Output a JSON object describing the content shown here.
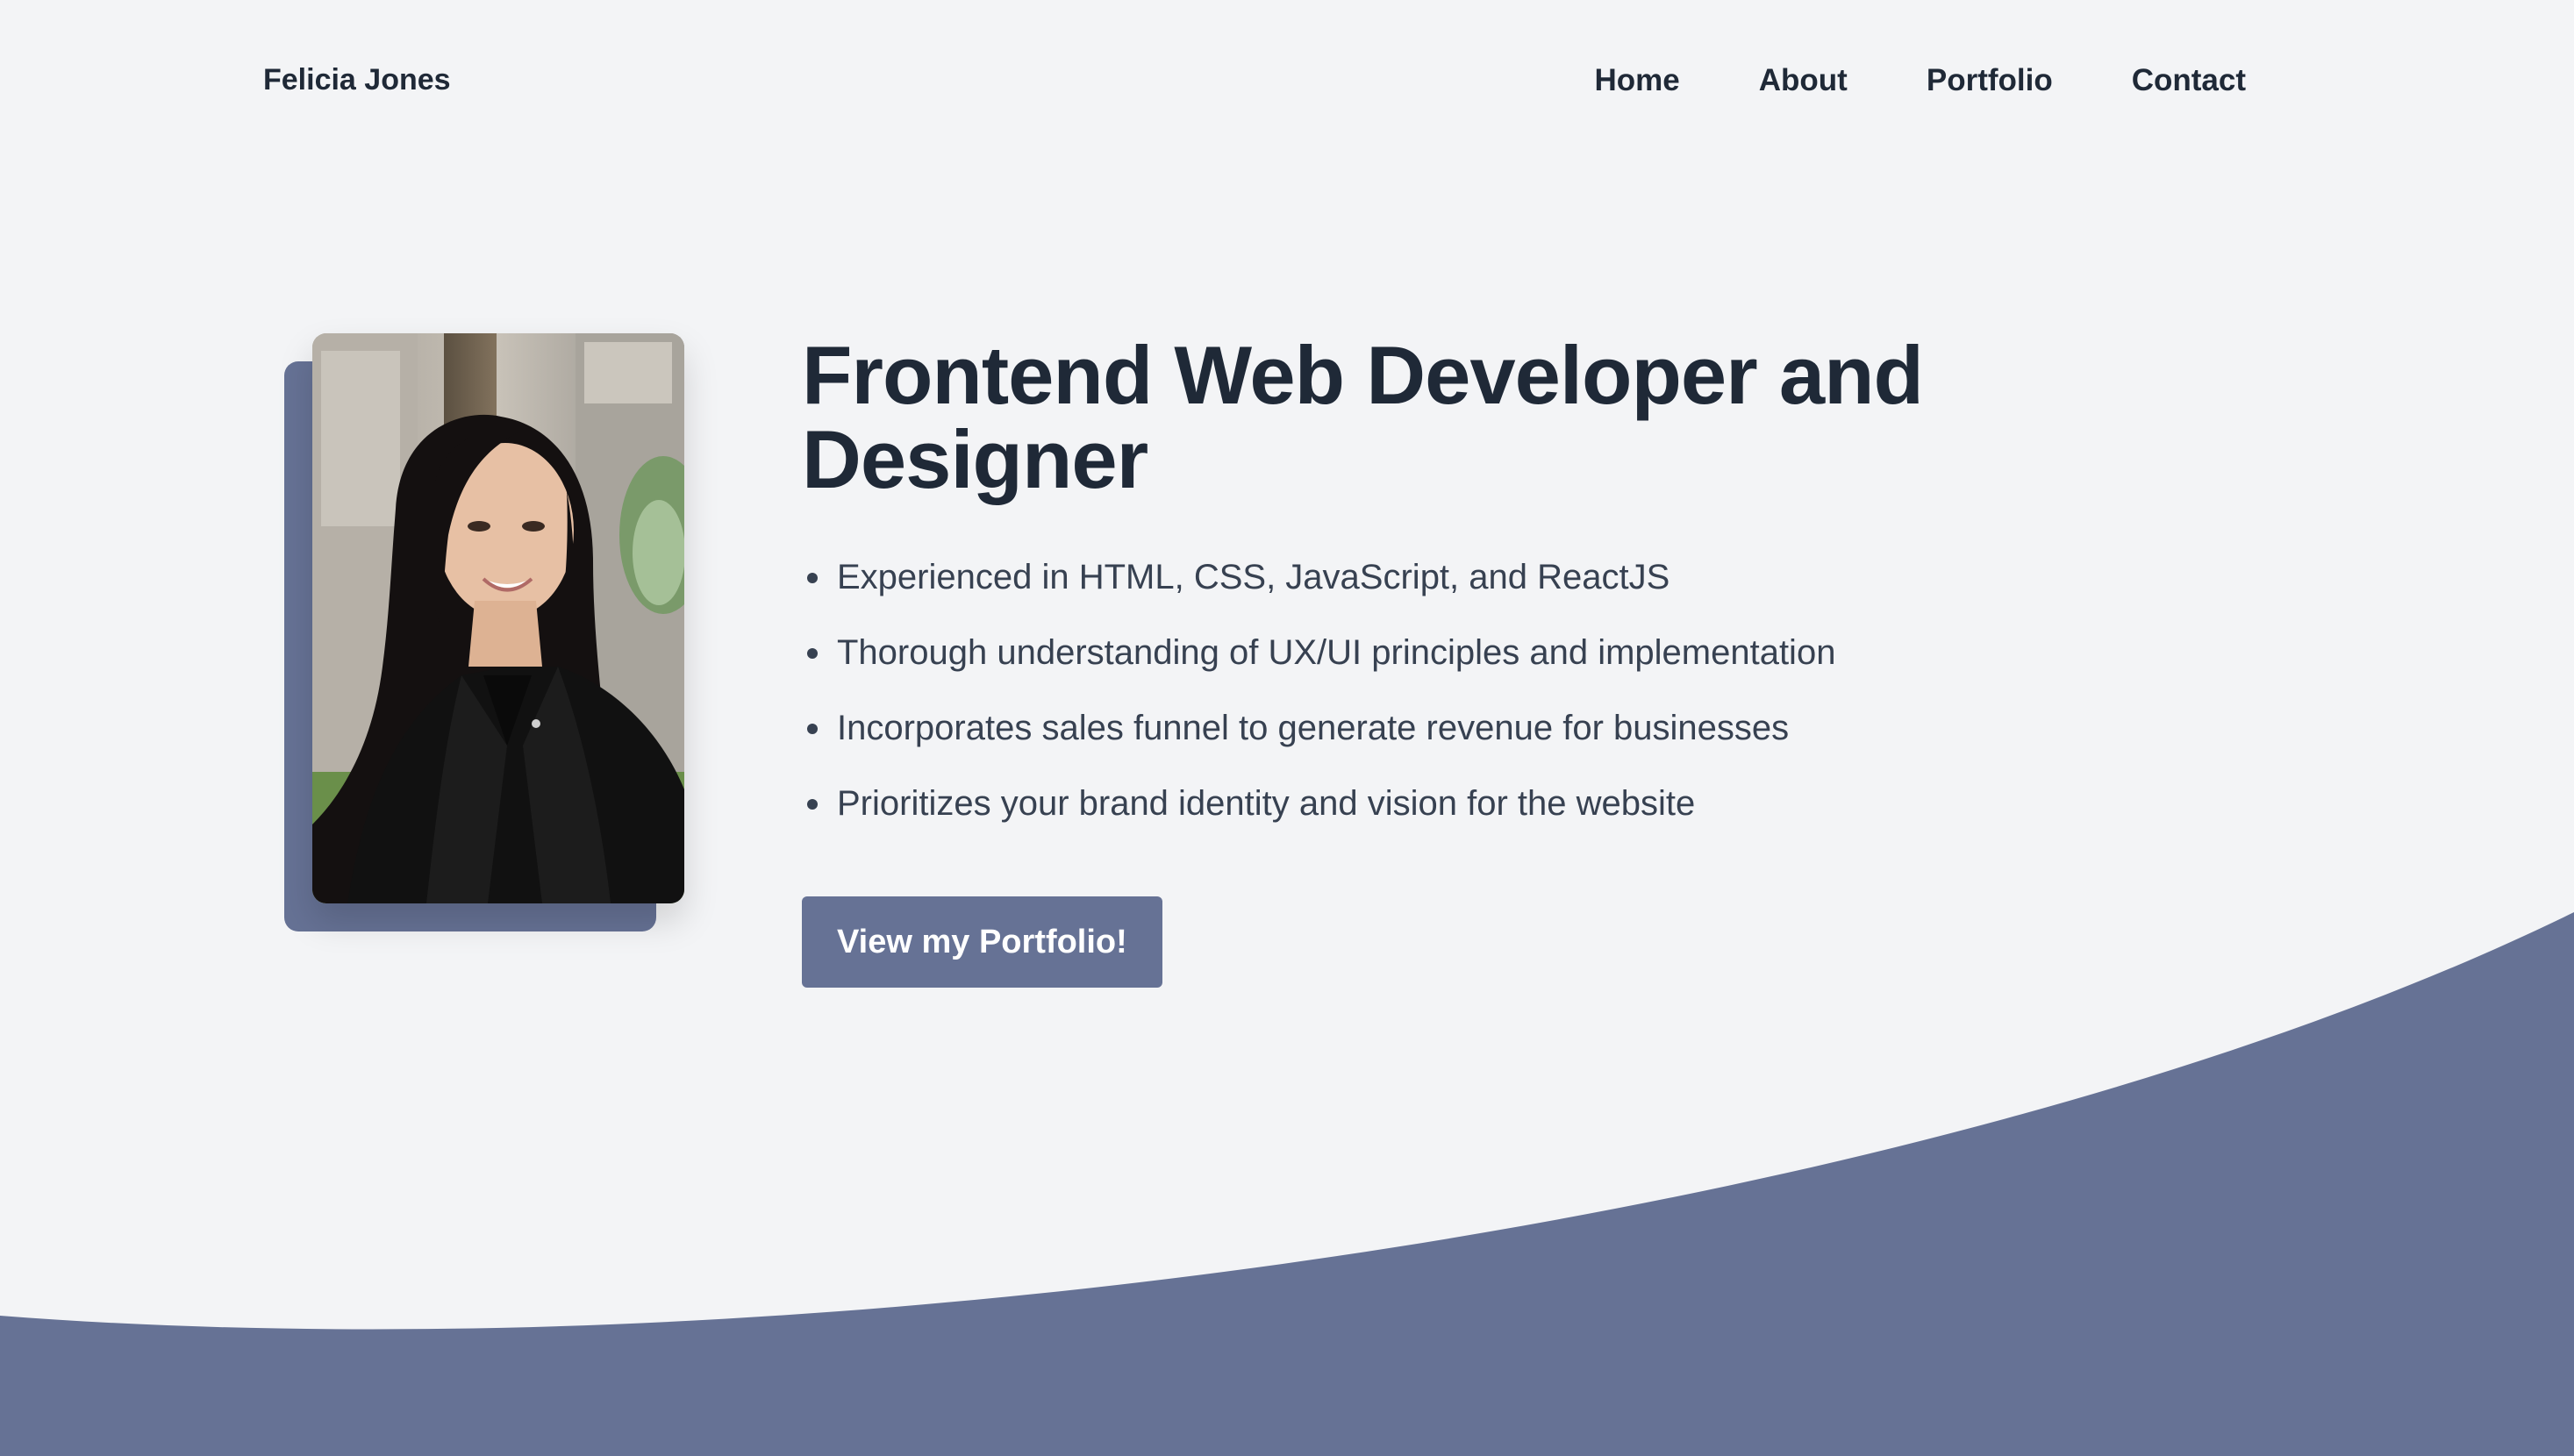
{
  "brand": {
    "name": "Felicia Jones"
  },
  "nav": {
    "items": [
      {
        "label": "Home"
      },
      {
        "label": "About"
      },
      {
        "label": "Portfolio"
      },
      {
        "label": "Contact"
      }
    ]
  },
  "hero": {
    "title": "Frontend Web Developer and Designer",
    "bullets": [
      "Experienced in HTML, CSS, JavaScript, and ReactJS",
      "Thorough understanding of UX/UI principles and implementation",
      "Incorporates sales funnel to generate revenue for businesses",
      "Prioritizes your brand identity and vision for the website"
    ],
    "cta_label": "View my Portfolio!",
    "photo_icon": "profile-photo"
  },
  "colors": {
    "background": "#f3f4f6",
    "accent": "#667295",
    "text": "#1f2937"
  }
}
